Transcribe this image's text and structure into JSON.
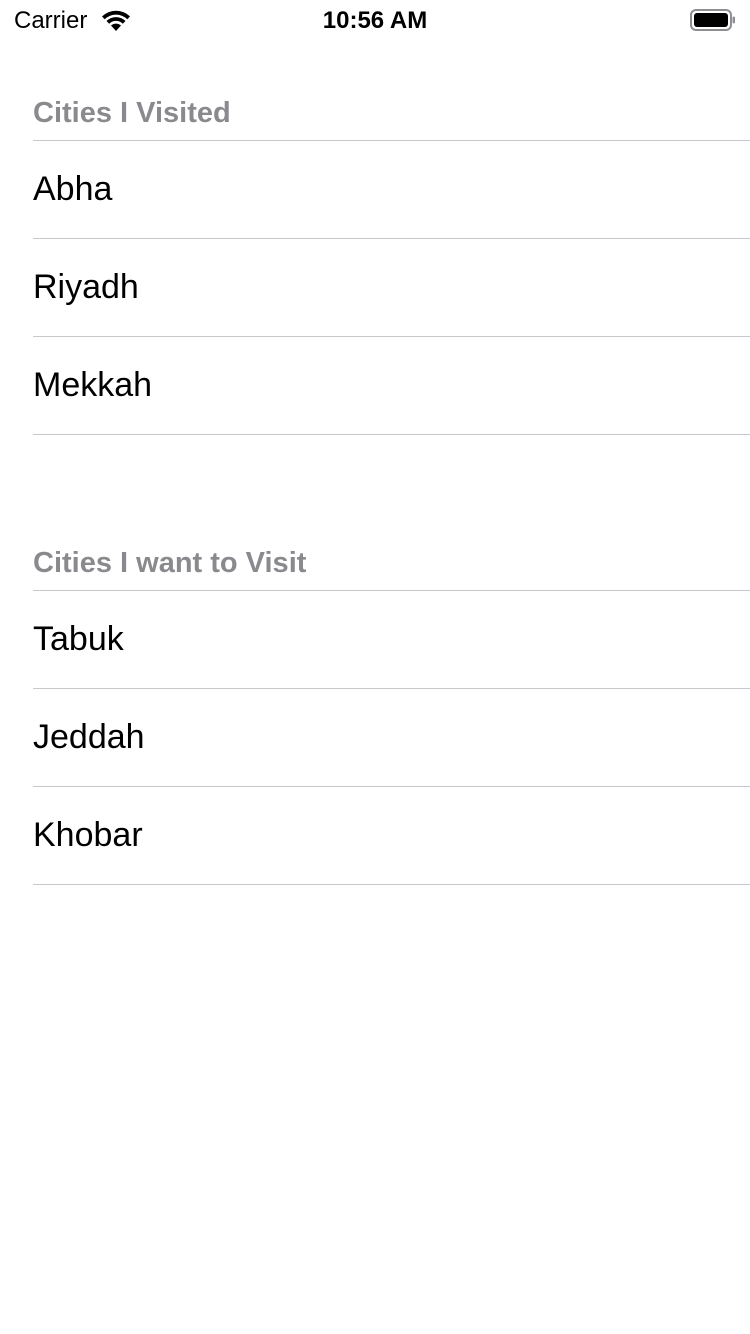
{
  "status_bar": {
    "carrier": "Carrier",
    "time": "10:56 AM",
    "wifi_icon": "wifi-icon",
    "battery_icon": "battery-icon"
  },
  "sections": [
    {
      "title": "Cities I Visited",
      "items": [
        "Abha",
        "Riyadh",
        "Mekkah"
      ]
    },
    {
      "title": "Cities I want to Visit",
      "items": [
        "Tabuk",
        "Jeddah",
        "Khobar"
      ]
    }
  ],
  "colors": {
    "header_text": "#8a8a8e",
    "separator": "#c8c8cc",
    "background": "#ffffff"
  }
}
